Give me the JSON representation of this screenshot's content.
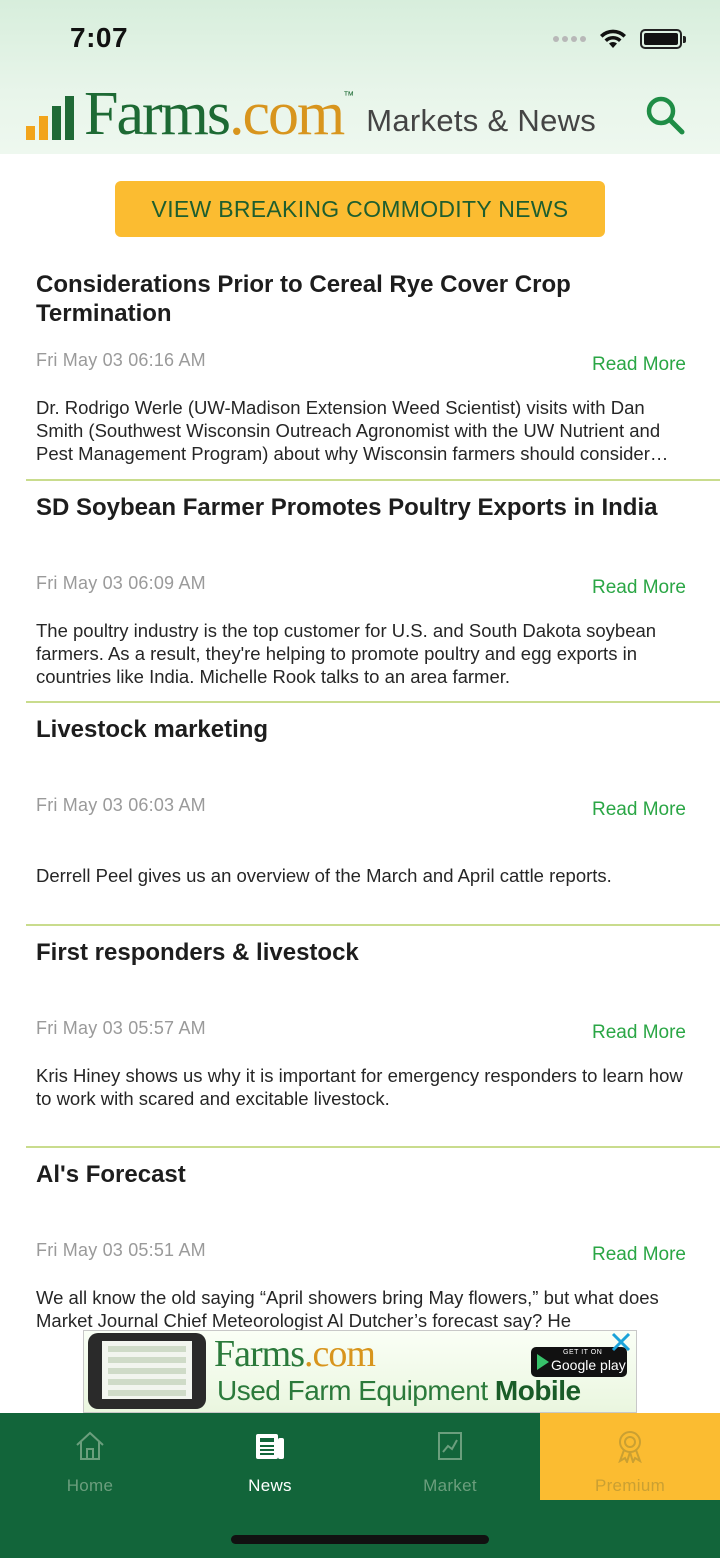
{
  "status_bar": {
    "time": "7:07"
  },
  "header": {
    "logo_main": "Farms",
    "logo_dot_com": ".com",
    "logo_tm": "™",
    "logo_subtitle": "Markets & News"
  },
  "breaking_button": {
    "label": "VIEW BREAKING COMMODITY NEWS"
  },
  "news": [
    {
      "title": "Considerations Prior to Cereal Rye Cover Crop Termination",
      "date": "Fri May 03 06:16 AM",
      "read_more": "Read More",
      "description": "Dr. Rodrigo Werle (UW-Madison Extension Weed Scientist) visits with Dan Smith (Southwest Wisconsin Outreach Agronomist with the UW Nutrient and Pest Management Program) about why Wisconsin farmers should consider some factors prior to cereal rye cover crop termination."
    },
    {
      "title": "SD Soybean Farmer Promotes Poultry Exports in India",
      "date": "Fri May 03 06:09 AM",
      "read_more": "Read More",
      "description": "The poultry industry is the top customer for U.S. and South Dakota soybean farmers.  As a result, they're helping to promote poultry and egg exports in countries like India.  Michelle Rook talks to an area farmer."
    },
    {
      "title": "Livestock marketing",
      "date": "Fri May 03 06:03 AM",
      "read_more": "Read More",
      "description": "Derrell Peel gives us an overview of the March and April cattle reports."
    },
    {
      "title": "First responders & livestock",
      "date": "Fri May 03 05:57 AM",
      "read_more": "Read More",
      "description": "Kris Hiney shows us why it is important for emergency responders to learn how to work with scared and excitable livestock."
    },
    {
      "title": "Al's Forecast",
      "date": "Fri May 03 05:51 AM",
      "read_more": "Read More",
      "description": "We all know the old saying “April showers bring May flowers,” but what does Market Journal Chief Meteorologist Al Dutcher’s forecast say? He"
    }
  ],
  "ad": {
    "logo_main": "Farms",
    "logo_dot_com": ".com",
    "text_regular": "Used Farm Equipment",
    "text_bold": "Mobile App",
    "badge_small": "GET IT ON",
    "badge_big": "Google play"
  },
  "tabs": [
    {
      "label": "Home",
      "icon": "home-icon",
      "active": false
    },
    {
      "label": "News",
      "icon": "news-icon",
      "active": true
    },
    {
      "label": "Market",
      "icon": "market-chart-icon",
      "active": false
    },
    {
      "label": "Premium",
      "icon": "award-ribbon-icon",
      "active": false
    }
  ],
  "colors": {
    "brand_green": "#1d6a34",
    "accent_gold": "#fbbc31",
    "link_green": "#2aa645",
    "tab_bar": "#12653a",
    "divider": "#c9dc8d"
  }
}
